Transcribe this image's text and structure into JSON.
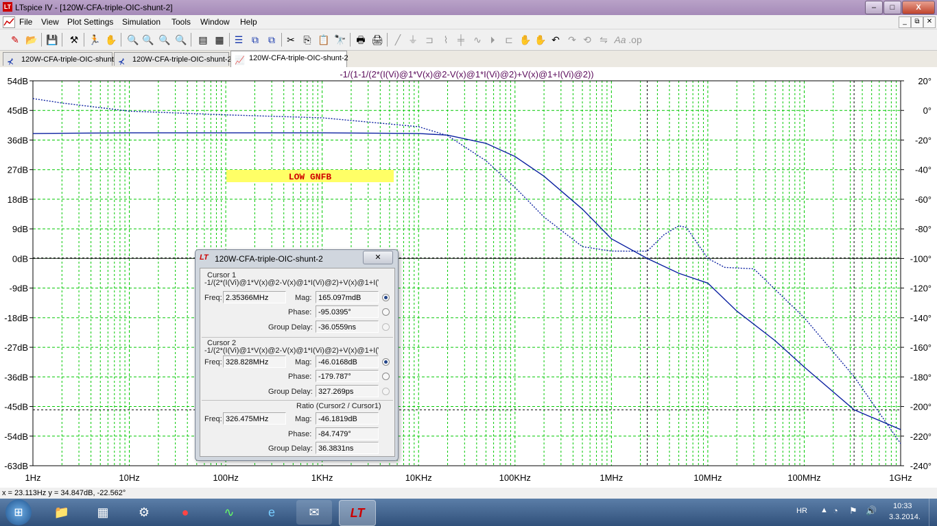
{
  "window": {
    "title": "LTspice IV - [120W-CFA-triple-OIC-shunt-2]",
    "min": "–",
    "max": "□",
    "close": "X",
    "inner_min": "_",
    "inner_max": "⧉",
    "inner_close": "✕"
  },
  "menu": [
    "File",
    "View",
    "Plot Settings",
    "Simulation",
    "Tools",
    "Window",
    "Help"
  ],
  "tabs": [
    "120W-CFA-triple-OIC-shunt",
    "120W-CFA-triple-OIC-shunt-2",
    "120W-CFA-triple-OIC-shunt-2"
  ],
  "plot": {
    "expression": "-1/(1-1/(2*(I(Vi)@1*V(x)@2-V(x)@1*I(Vi)@2)+V(x)@1+I(Vi)@2))",
    "annotation": "LOW GNFB",
    "grid_color": "#00c800",
    "trace_color": "#0a1fa0"
  },
  "chart_data": {
    "type": "line",
    "xscale": "log",
    "xlim": [
      1,
      1000000000
    ],
    "x_ticks": [
      "1Hz",
      "10Hz",
      "100Hz",
      "1KHz",
      "10KHz",
      "100KHz",
      "1MHz",
      "10MHz",
      "100MHz",
      "1GHz"
    ],
    "y_left_ticks": [
      "54dB",
      "45dB",
      "36dB",
      "27dB",
      "18dB",
      "9dB",
      "0dB",
      "-9dB",
      "-18dB",
      "-27dB",
      "-36dB",
      "-45dB",
      "-54dB",
      "-63dB"
    ],
    "y_right_ticks": [
      "20°",
      "0°",
      "-20°",
      "-40°",
      "-60°",
      "-80°",
      "-100°",
      "-120°",
      "-140°",
      "-160°",
      "-180°",
      "-200°",
      "-220°",
      "-240°"
    ],
    "ylim_db": [
      -63,
      54
    ],
    "ylim_deg": [
      -240,
      20
    ],
    "series": [
      {
        "style": "solid",
        "axis": "db",
        "x": [
          1,
          10,
          100,
          1000,
          10000,
          20000,
          50000,
          100000,
          200000,
          500000,
          1000000,
          2353660,
          5000000,
          10000000,
          20000000,
          50000000,
          100000000,
          328828000,
          1000000000
        ],
        "y": [
          38,
          38.2,
          38.2,
          38.2,
          38,
          37.5,
          35,
          31,
          25,
          15,
          6,
          0,
          -4.5,
          -7.5,
          -16,
          -25,
          -33,
          -46,
          -52
        ]
      },
      {
        "style": "dotted",
        "axis": "deg",
        "x": [
          1,
          2,
          10,
          100,
          1000,
          10000,
          20000,
          50000,
          100000,
          200000,
          500000,
          1000000,
          2353660,
          3500000,
          5000000,
          6000000,
          10000000,
          15000000,
          30000000,
          100000000,
          328828000,
          1000000000
        ],
        "y": [
          8,
          5,
          -0.5,
          -3,
          -5,
          -11,
          -17,
          -34,
          -52,
          -72,
          -92,
          -95,
          -95.04,
          -84,
          -78,
          -79,
          -100,
          -106,
          -107,
          -140,
          -179.787,
          -225
        ]
      }
    ],
    "cursors": [
      {
        "x": 2353660,
        "y_db": 0.165
      },
      {
        "x": 328828000,
        "y_db": -46.0168
      }
    ]
  },
  "cursor_dialog": {
    "title": "120W-CFA-triple-OIC-shunt-2",
    "close": "✕",
    "cursor1": {
      "heading": "Cursor 1",
      "expr": "-1/(2*(I(Vi)@1*V(x)@2-V(x)@1*I(Vi)@2)+V(x)@1+I(Vi)(",
      "freq_label": "Freq:",
      "freq": "2.35366MHz",
      "mag_label": "Mag:",
      "mag": "165.097mdB",
      "phase_label": "Phase:",
      "phase": "-95.0395°",
      "gd_label": "Group Delay:",
      "gd": "-36.0559ns"
    },
    "cursor2": {
      "heading": "Cursor 2",
      "expr": "-1/(2*(I(Vi)@1*V(x)@2-V(x)@1*I(Vi)@2)+V(x)@1+I(Vi)(",
      "freq_label": "Freq:",
      "freq": "328.828MHz",
      "mag_label": "Mag:",
      "mag": "-46.0168dB",
      "phase_label": "Phase:",
      "phase": "-179.787°",
      "gd_label": "Group Delay:",
      "gd": "327.269ps"
    },
    "ratio": {
      "heading": "Ratio (Cursor2 / Cursor1)",
      "freq_label": "Freq:",
      "freq": "326.475MHz",
      "mag_label": "Mag:",
      "mag": "-46.1819dB",
      "phase_label": "Phase:",
      "phase": "-84.7479°",
      "gd_label": "Group Delay:",
      "gd": "36.3831ns"
    }
  },
  "status": "x = 23.113Hz   y = 34.847dB, -22.562°",
  "taskbar": {
    "lang": "HR",
    "time": "10:33",
    "date": "3.3.2014."
  }
}
